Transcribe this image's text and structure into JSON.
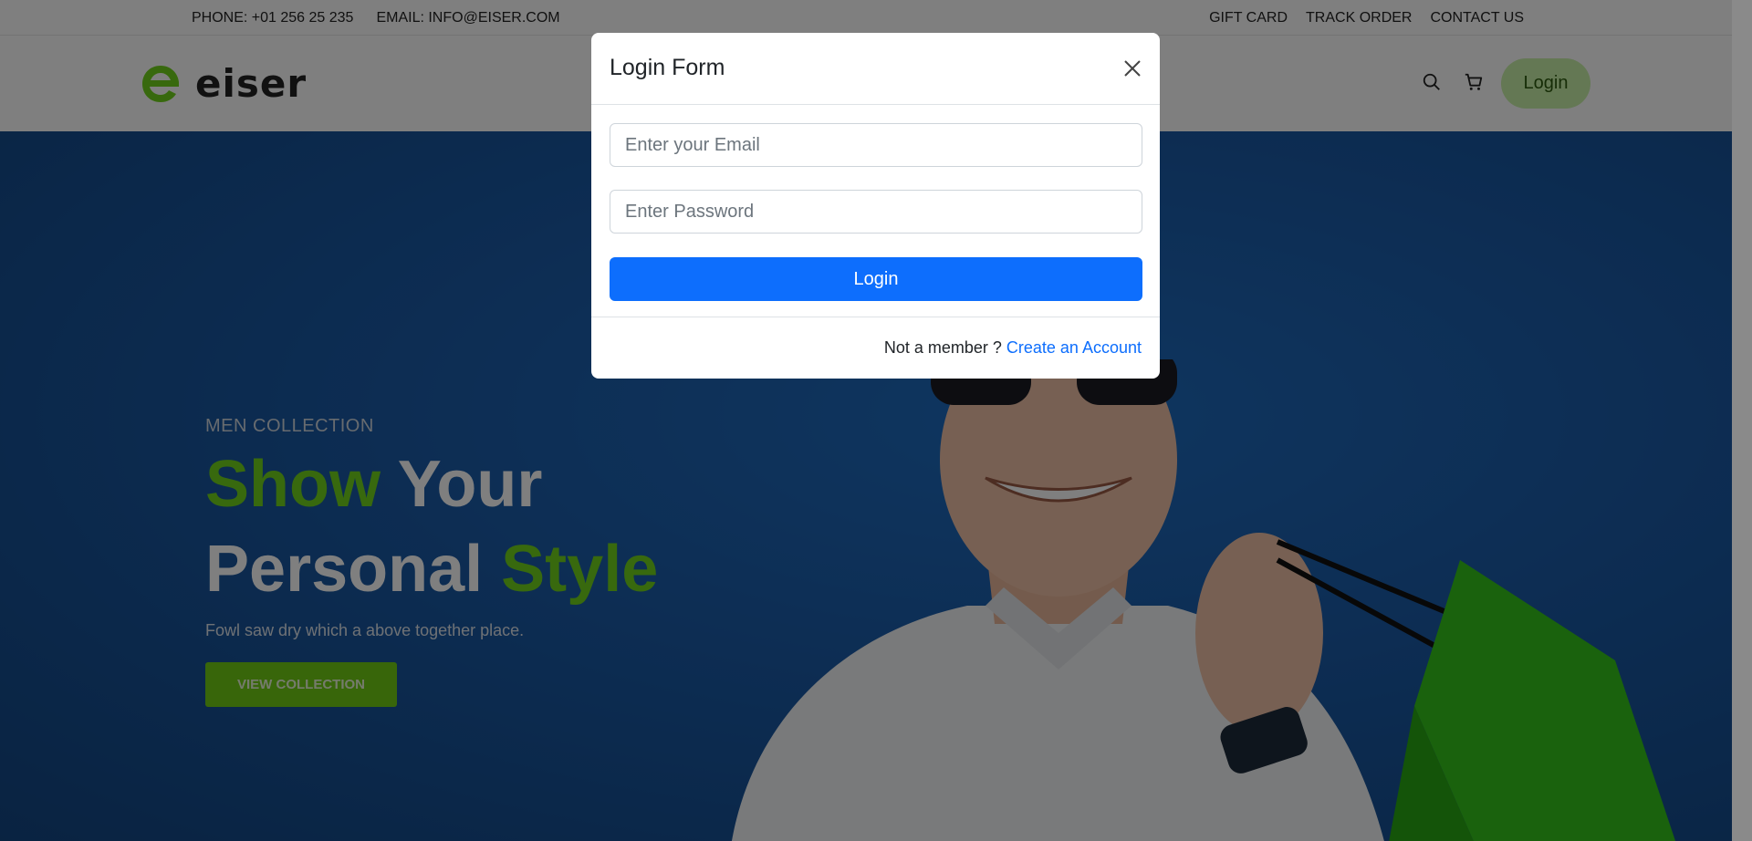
{
  "topbar": {
    "phone": "PHONE: +01 256 25 235",
    "email": "EMAIL: INFO@EISER.COM",
    "links": [
      "GIFT CARD",
      "TRACK ORDER",
      "CONTACT US"
    ]
  },
  "header": {
    "logo_text": "eiser",
    "icons": [
      "search-icon",
      "cart-icon"
    ],
    "login_label": "Login"
  },
  "hero": {
    "eyebrow": "MEN COLLECTION",
    "title_word1": "Show",
    "title_word2": " Your",
    "title_word3": "Personal",
    "title_word4": " Style",
    "subtitle": "Fowl saw dry which a above together place.",
    "cta": "VIEW COLLECTION"
  },
  "modal": {
    "title": "Login Form",
    "email_placeholder": "Enter your Email",
    "password_placeholder": "Enter Password",
    "submit_label": "Login",
    "footer_text": "Not a member ? ",
    "footer_link": "Create an Account"
  },
  "colors": {
    "brand_green": "#71d31c",
    "primary_blue": "#0d6efd",
    "hero_blue": "#1a5aa6"
  }
}
